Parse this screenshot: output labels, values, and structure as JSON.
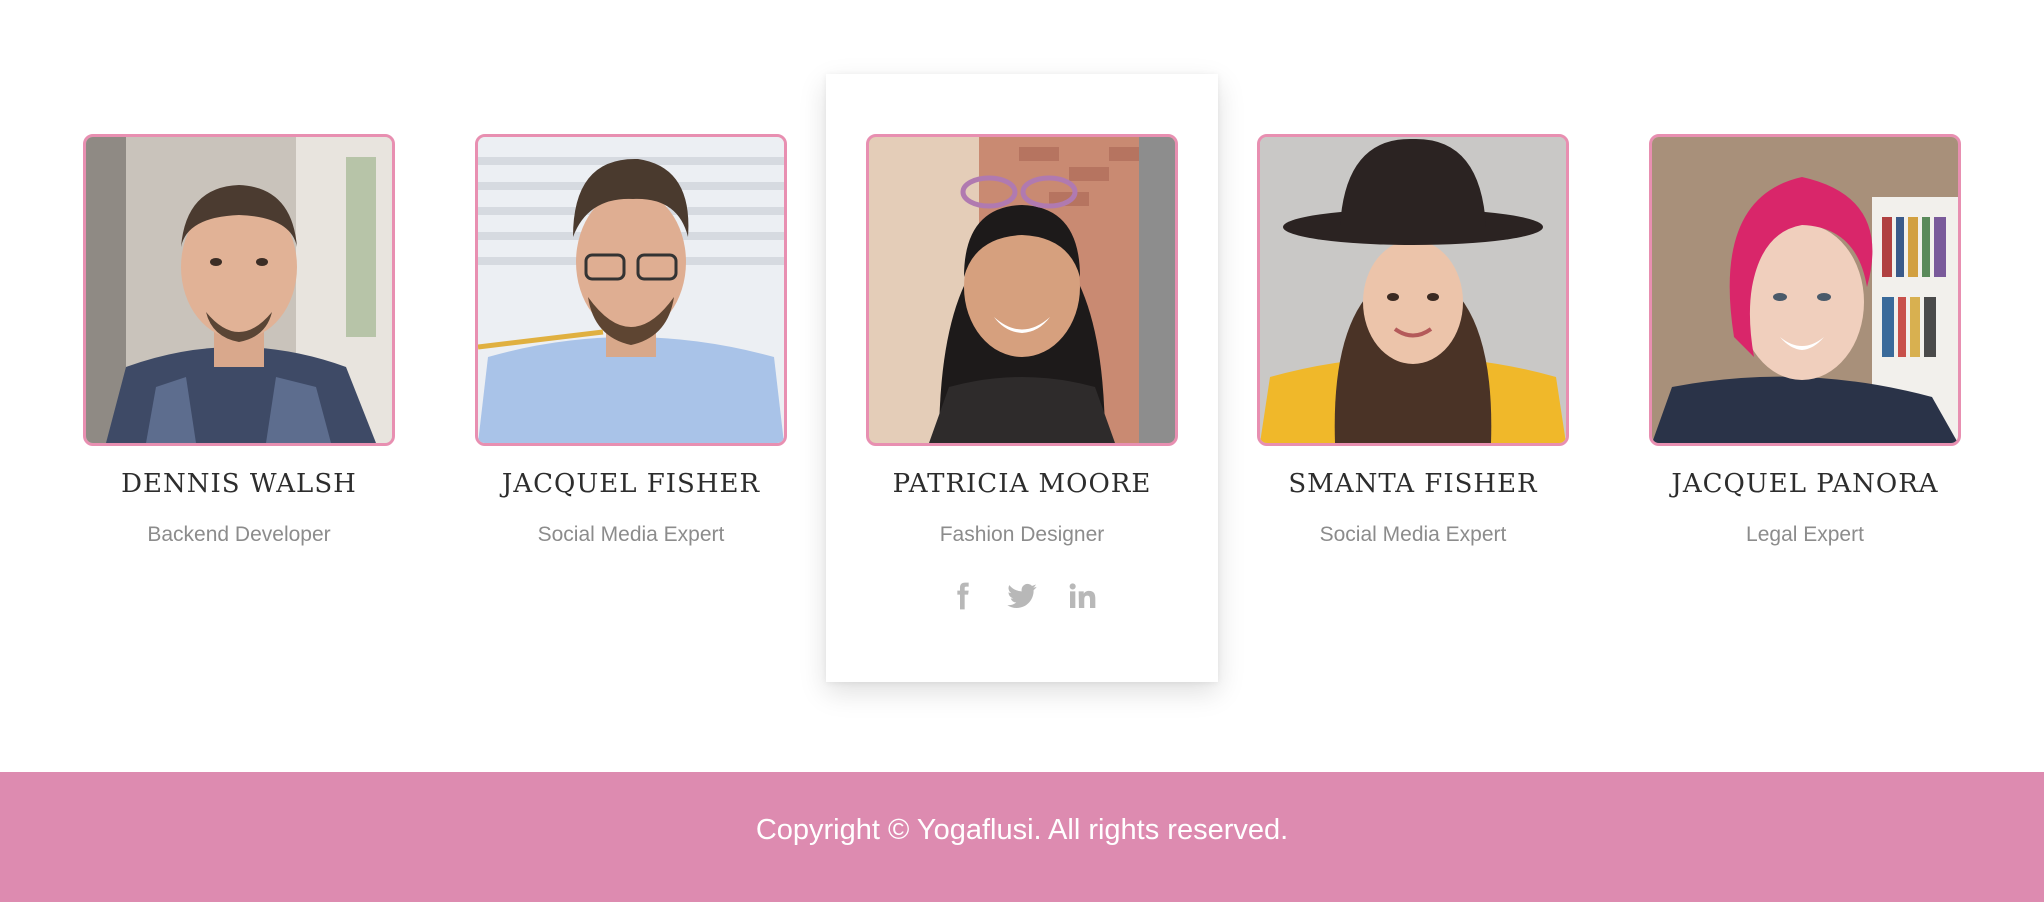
{
  "team": {
    "members": [
      {
        "name": "DENNIS WALSH",
        "role": "Backend Developer"
      },
      {
        "name": "JACQUEL FISHER",
        "role": "Social Media Expert"
      },
      {
        "name": "PATRICIA MOORE",
        "role": "Fashion Designer",
        "social": [
          "facebook-icon",
          "twitter-icon",
          "linkedin-icon"
        ]
      },
      {
        "name": "SMANTA FISHER",
        "role": "Social Media Expert"
      },
      {
        "name": "JACQUEL PANORA",
        "role": "Legal Expert"
      }
    ]
  },
  "footer": {
    "copyright": "Copyright © Yogaflusi. All rights reserved."
  },
  "colors": {
    "accent_pink": "#dd8bb0",
    "photo_border": "#e88fb1",
    "name_text": "#2d2d2d",
    "role_text": "#8c8c8c",
    "social_icon": "#b8b8b8"
  }
}
